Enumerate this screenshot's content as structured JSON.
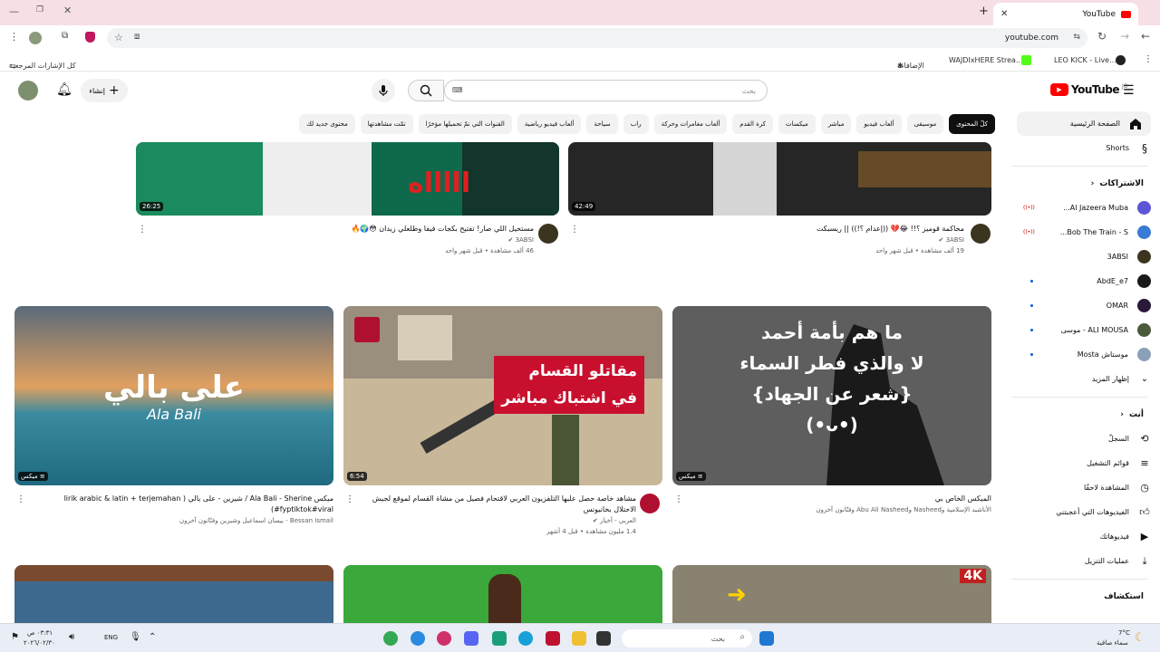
{
  "browser": {
    "tab_title": "YouTube",
    "url": "youtube.com",
    "bookmarks_folder": "كل الإشارات المرجعية",
    "bookmarks": [
      "الإضافات",
      "WAJDIxHERE Strea...",
      "LEO KICK - Live..."
    ]
  },
  "yt": {
    "logo": "YouTube",
    "region": "JO",
    "search_placeholder": "بحث",
    "create_label": "إنشاء",
    "chips": [
      "كلّ المحتوى",
      "موسيقى",
      "ألعاب فيديو",
      "مباشر",
      "ميكسات",
      "كرة القدم",
      "ألعاب مغامرات وحركة",
      "راب",
      "سياحة",
      "ألعاب فيديو رياضية",
      "القنوات التي تمّ تحميلها مؤخرًا",
      "تمّت مشاهدتها",
      "محتوى جديد لك"
    ]
  },
  "sidebar": {
    "home": "الصفحة الرئيسية",
    "shorts": "Shorts",
    "subs_header": "الاشتراكات",
    "subs": [
      {
        "name": "Al Jazeera Muba...",
        "live": true,
        "color": "#5b56d6"
      },
      {
        "name": "Bob The Train - S...",
        "live": true,
        "color": "#3a7bd5"
      },
      {
        "name": "3ABSI",
        "live": false,
        "color": "#3b3520"
      },
      {
        "name": "AbdE_e7",
        "live": false,
        "dot": true,
        "color": "#1a1a1a"
      },
      {
        "name": "OMAR",
        "live": false,
        "dot": true,
        "color": "#2a1a3a"
      },
      {
        "name": "ALI MOUSA - موسى",
        "live": false,
        "dot": true,
        "color": "#4a5a3a"
      },
      {
        "name": "موستاش Mosta",
        "live": false,
        "dot": true,
        "color": "#8aa0b8"
      }
    ],
    "show_more": "إظهار المزيد",
    "you_header": "أنت",
    "you_items": [
      "السجلّ",
      "قوائم التشغيل",
      "المشاهدة لاحقًا",
      "الفيديوهات التي أعجبتني",
      "فيديوهاتك",
      "عمليات التنزيل"
    ],
    "explore_header": "استكشاف"
  },
  "videos_row1": [
    {
      "duration": "42:49",
      "title": "محاكمة قوميز ؟!! 😂💔 ((إعدام ؟!)) || ريسبكت",
      "channel": "3ABSI",
      "views": "19 ألف مشاهدة • قبل شهر واحد"
    },
    {
      "duration": "26:25",
      "title": "مستحيل اللي صار! تفتيح بكجات فيفا وطلعلي زيدان 😳🌍🔥",
      "channel": "3ABSI",
      "views": "46 ألف مشاهدة • قبل شهر واحد"
    }
  ],
  "videos_row2": [
    {
      "badge": "ميكس",
      "overlay": [
        "ما هم بأمة أحمد",
        "لا والذي فطر السماء",
        "{شعر عن الجهاد}",
        "(•ᴗ•)"
      ],
      "title": "الميكس الخاص بي",
      "sub": "الأناشيد الإسلامية وNasheed وAbu Ali Nasheed وفنّانون آخرون"
    },
    {
      "duration": "6:54",
      "overlay": [
        "مقاتلو القسام",
        "في اشتباك مباشر"
      ],
      "title": "مشاهد خاصة حصل عليها التلفزيون العربي لاقتحام فصيل من مشاة القسام لموقع لجيش الاحتلال بخانيونس",
      "channel": "العربي - أخبار",
      "views": "1.4 مليون مشاهدة • قبل 4 أشهر"
    },
    {
      "badge": "ميكس",
      "overlay": [
        "على بالي",
        "Ala Bali"
      ],
      "title": "ميكس Ala Bali - Sherine / شيرين - على بالي ( lirik arabic & latin + terjemahan fyptiktok#viral#)",
      "sub": "Bessan Ismail - بيسان اسماعيل وشيرين وفنّانون آخرون"
    }
  ],
  "row3_badge": "4K",
  "taskbar": {
    "weather_temp": "7°C",
    "weather_desc": "سماء صافية",
    "search": "بحث",
    "lang": "ENG",
    "time": "٠٣:٣١ ص",
    "date": "٢٠٢٦/٠٢/٣٠"
  },
  "colors": {
    "accent": "#ff0000",
    "link": "#065fd4"
  }
}
